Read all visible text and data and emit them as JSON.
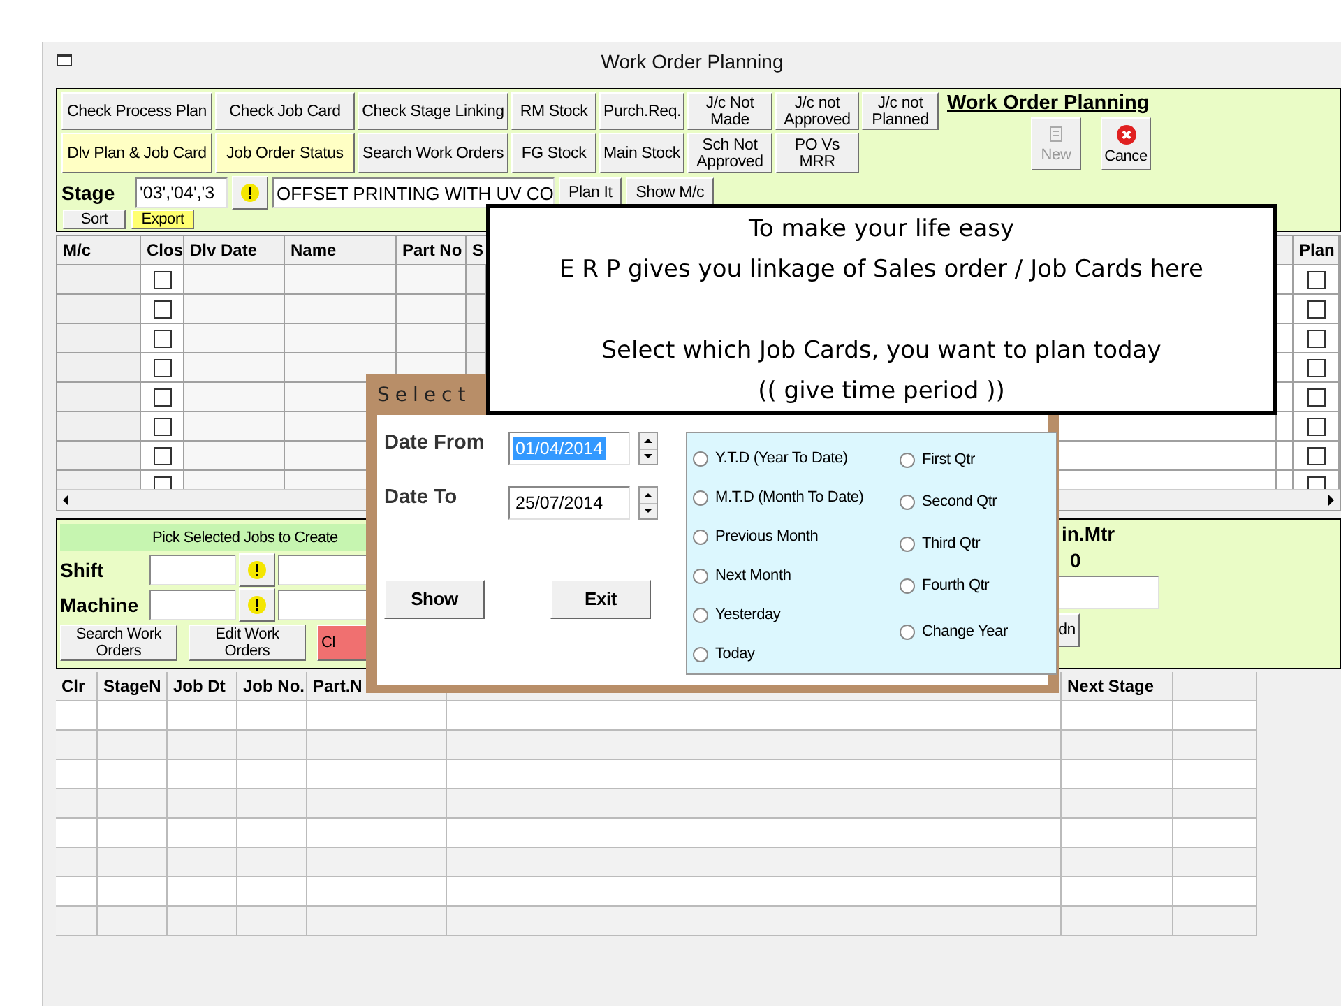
{
  "window": {
    "title": "Work Order Planning"
  },
  "toolbar": {
    "buttons": [
      {
        "label": "Check Process Plan",
        "highlighted": false
      },
      {
        "label": "Check Job Card",
        "highlighted": false
      },
      {
        "label": "Check Stage Linking",
        "highlighted": false
      },
      {
        "label": "RM Stock",
        "highlighted": false
      },
      {
        "label": "Purch.Req.",
        "highlighted": false
      },
      {
        "label": "J/c Not Made",
        "highlighted": false
      },
      {
        "label": "J/c not Approved",
        "highlighted": false
      },
      {
        "label": "J/c not Planned",
        "highlighted": false
      },
      {
        "label": "Dlv Plan & Job Card",
        "highlighted": true
      },
      {
        "label": "Job Order Status",
        "highlighted": true
      },
      {
        "label": "Search Work Orders",
        "highlighted": false
      },
      {
        "label": "FG Stock",
        "highlighted": false
      },
      {
        "label": "Main Stock",
        "highlighted": false
      },
      {
        "label": "Sch Not Approved",
        "highlighted": false
      },
      {
        "label": "PO Vs MRR",
        "highlighted": false
      }
    ],
    "heading": "Work Order Planning",
    "actions": [
      {
        "label": "New",
        "kind": "new",
        "disabled": true
      },
      {
        "label": "Cance",
        "kind": "cancel",
        "disabled": false
      }
    ]
  },
  "stage": {
    "label": "Stage",
    "code": "'03','04','3",
    "name": "OFFSET PRINTING WITH UV CO",
    "buttons": [
      "Plan It",
      "Show M/c"
    ]
  },
  "list_buttons": [
    {
      "label": "Sort",
      "highlighted": false
    },
    {
      "label": "Export",
      "highlighted": true
    }
  ],
  "job_grid": {
    "columns": [
      {
        "label": "M/c",
        "kind": "text"
      },
      {
        "label": "Clos",
        "kind": "check"
      },
      {
        "label": "Dlv Date",
        "kind": "text"
      },
      {
        "label": "Name",
        "kind": "text"
      },
      {
        "label": "Part No",
        "kind": "text"
      },
      {
        "label": "S",
        "kind": "text"
      },
      {
        "label": "Plan",
        "kind": "check"
      }
    ],
    "rows": [
      {
        "checks": [
          false,
          false
        ]
      },
      {
        "checks": [
          false,
          false
        ]
      },
      {
        "checks": [
          false,
          false
        ]
      },
      {
        "checks": [
          false,
          false
        ]
      },
      {
        "checks": [
          false,
          false
        ]
      },
      {
        "checks": [
          false,
          false
        ]
      },
      {
        "checks": [
          false,
          false
        ]
      },
      {
        "checks": [
          false,
          false
        ]
      }
    ]
  },
  "pick_panel": {
    "banner": "Pick Selected Jobs to Create",
    "fields": [
      {
        "label": "Shift"
      },
      {
        "label": "Machine"
      }
    ],
    "buttons": [
      {
        "label": "Search Work Orders",
        "kind": "normal"
      },
      {
        "label": "Edit Work Orders",
        "kind": "normal"
      },
      {
        "label": "Cl",
        "kind": "danger"
      }
    ],
    "metric_label": "in.Mtr",
    "metric_value": "0",
    "side_button": "dn"
  },
  "work_grid": {
    "columns": [
      {
        "label": "Clr"
      },
      {
        "label": "StageN"
      },
      {
        "label": "Job Dt"
      },
      {
        "label": "Job No."
      },
      {
        "label": "Part.N"
      },
      {
        "label": "Next Stage"
      }
    ]
  },
  "callout": {
    "lines": [
      "To make your life easy",
      "E R P  gives you linkage of Sales order / Job Cards here",
      "Select which Job Cards, you want to plan today",
      "(( give time period ))"
    ]
  },
  "dialog": {
    "title": "Select",
    "dates": [
      {
        "label": "Date From",
        "value": "01/04/2014",
        "text_selected": true
      },
      {
        "label": "Date To",
        "value": "25/07/2014",
        "text_selected": false
      }
    ],
    "buttons": [
      "Show",
      "Exit"
    ],
    "periods_left": [
      {
        "label": "Y.T.D (Year To Date)",
        "selected": false
      },
      {
        "label": "M.T.D (Month To Date)",
        "selected": false
      },
      {
        "label": "Previous Month",
        "selected": false
      },
      {
        "label": "Next Month",
        "selected": false
      },
      {
        "label": "Yesterday",
        "selected": false
      },
      {
        "label": "Today",
        "selected": false
      }
    ],
    "periods_right": [
      {
        "label": "First Qtr",
        "selected": false
      },
      {
        "label": "Second Qtr",
        "selected": false
      },
      {
        "label": "Third Qtr",
        "selected": false
      },
      {
        "label": "Fourth Qtr",
        "selected": false
      },
      {
        "label": "Change Year",
        "selected": false
      }
    ]
  }
}
